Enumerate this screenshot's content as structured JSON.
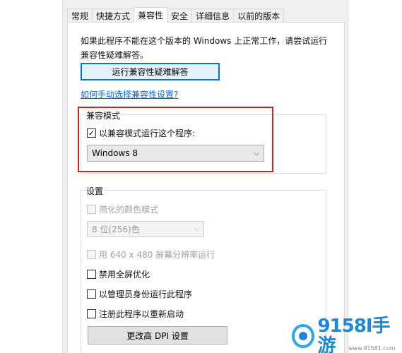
{
  "tabs": [
    {
      "label": "常规"
    },
    {
      "label": "快捷方式"
    },
    {
      "label": "兼容性"
    },
    {
      "label": "安全"
    },
    {
      "label": "详细信息"
    },
    {
      "label": "以前的版本"
    }
  ],
  "active_tab": "兼容性",
  "intro_text": "如果此程序不能在这个版本的 Windows 上正常工作，请尝试运行兼容性疑难解答。",
  "troubleshooter_button": "运行兼容性疑难解答",
  "manual_link": "如何手动选择兼容性设置?",
  "compat_mode": {
    "group_title": "兼容模式",
    "checkbox_label": "以兼容模式运行这个程序:",
    "checked": true,
    "selected_os": "Windows 8"
  },
  "settings": {
    "group_title": "设置",
    "reduced_color": {
      "label": "简化的颜色模式",
      "checked": false,
      "enabled": false
    },
    "color_select": "8 位(256)色",
    "low_res": {
      "label": "用 640 x 480 屏幕分辨率运行",
      "checked": false,
      "enabled": false
    },
    "disable_fullscreen": {
      "label": "禁用全屏优化",
      "checked": false
    },
    "run_as_admin": {
      "label": "以管理员身份运行此程序",
      "checked": false
    },
    "register_restart": {
      "label": "注册此程序以重新启动",
      "checked": false
    },
    "dpi_button": "更改高 DPI 设置"
  },
  "watermark": {
    "text": "9158I手游",
    "url": "www.91581.com"
  },
  "colors": {
    "highlight": "#d32222",
    "link": "#0066cc",
    "focus": "#0078d7",
    "watermark": "#1e88d6"
  },
  "icons": {
    "check": "checkmark-icon",
    "dropdown": "chevron-down-icon"
  }
}
